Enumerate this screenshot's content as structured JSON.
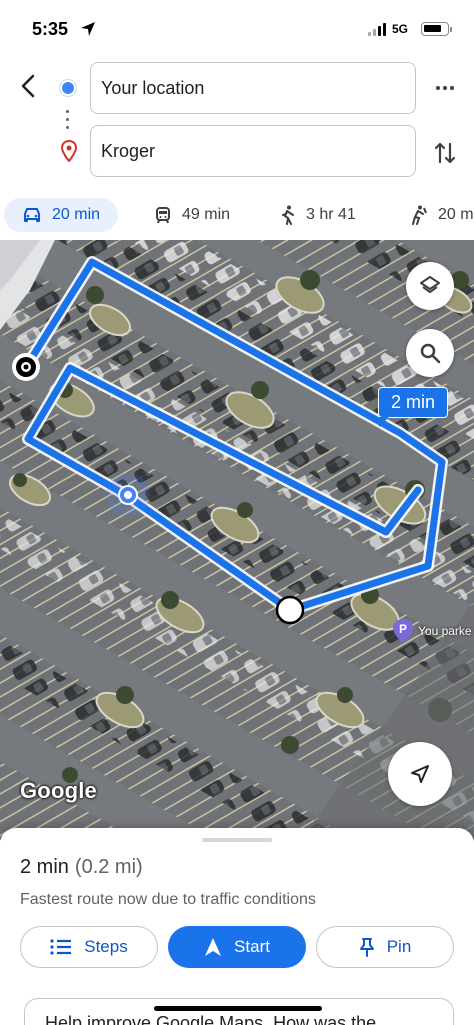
{
  "status_bar": {
    "time": "5:35",
    "network": "5G",
    "icons": [
      "location-arrow-icon",
      "signal-icon",
      "battery-icon"
    ]
  },
  "route": {
    "origin": "Your location",
    "destination": "Kroger",
    "icons": [
      "back-icon",
      "origin-dot-icon",
      "destination-pin-icon",
      "more-icon",
      "swap-icon"
    ]
  },
  "modes": [
    {
      "label": "20 min",
      "icon": "car-icon",
      "active": true
    },
    {
      "label": "49 min",
      "icon": "transit-icon",
      "active": false
    },
    {
      "label": "3 hr 41",
      "icon": "walk-icon",
      "active": false
    },
    {
      "label": "20 m",
      "icon": "rideshare-icon",
      "active": false
    }
  ],
  "map": {
    "eta_callout": "2 min",
    "attribution": "Google",
    "poi_label": "You parke",
    "route_color": "#1a73e8",
    "buttons": [
      "layers-icon",
      "search-icon",
      "navigate-icon"
    ]
  },
  "sheet": {
    "duration": "2 min",
    "distance": "(0.2 mi)",
    "description": "Fastest route now due to traffic conditions",
    "steps_label": "Steps",
    "start_label": "Start",
    "pin_label": "Pin",
    "feedback_text": "Help improve Google Maps. How was the"
  },
  "colors": {
    "accent": "#1a73e8",
    "active_tab_bg": "#e8f0fe",
    "active_tab_text": "#0b57d0"
  }
}
